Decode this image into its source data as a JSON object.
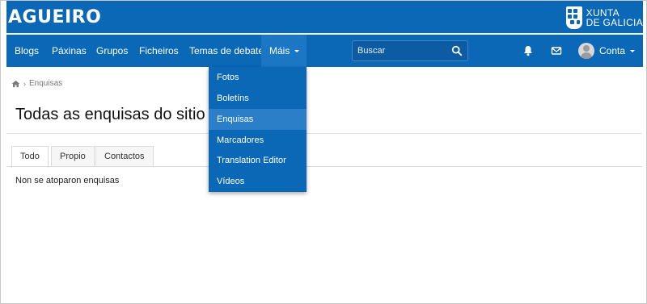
{
  "header": {
    "site_title": "AGUEIRO",
    "logo": {
      "line1": "XUNTA",
      "line2": "DE GALICIA"
    }
  },
  "nav": {
    "items": [
      {
        "label": "Blogs"
      },
      {
        "label": "Páxinas"
      },
      {
        "label": "Grupos"
      },
      {
        "label": "Ficheiros"
      },
      {
        "label": "Temas de debate"
      },
      {
        "label": "Máis",
        "active": true
      }
    ],
    "search_placeholder": "Buscar",
    "account_label": "Conta"
  },
  "dropdown": {
    "items": [
      {
        "label": "Fotos"
      },
      {
        "label": "Boletíns"
      },
      {
        "label": "Enquisas",
        "active": true
      },
      {
        "label": "Marcadores"
      },
      {
        "label": "Translation Editor"
      },
      {
        "label": "Vídeos"
      }
    ]
  },
  "breadcrumb": {
    "current": "Enquisas"
  },
  "page": {
    "title": "Todas as enquisas do sitio",
    "empty_message": "Non se atoparon enquisas"
  },
  "tabs": [
    {
      "label": "Todo",
      "active": true
    },
    {
      "label": "Propio"
    },
    {
      "label": "Contactos"
    }
  ],
  "colors": {
    "header_bg": "#0b68b7",
    "active_item_bg": "#2a7fc8"
  }
}
